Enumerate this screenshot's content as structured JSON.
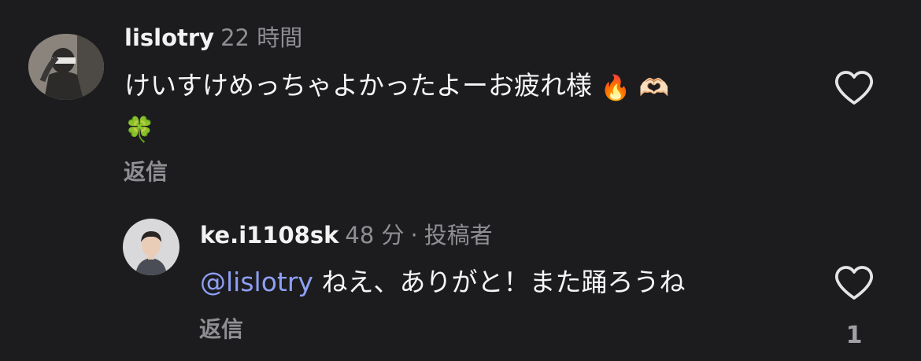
{
  "comments": [
    {
      "username": "lislotry",
      "time": "22 時間",
      "text": "けいすけめっちゃよかったよーお疲れ様",
      "emojis": [
        "🔥",
        "🫶🏻",
        "🍀"
      ],
      "reply_label": "返信",
      "like_icon": "heart-outline-icon"
    },
    {
      "username": "ke.i1108sk",
      "time": "48 分",
      "separator": "·",
      "author_tag": "投稿者",
      "mention": "@lislotry",
      "text": "ねえ、ありがと！また踊ろうね",
      "reply_label": "返信",
      "like_icon": "heart-outline-icon",
      "like_count": "1"
    }
  ],
  "colors": {
    "background": "#1c1c1f",
    "text": "#f5f5f5",
    "muted": "#8e8e93",
    "mention": "#8ea0f5"
  }
}
